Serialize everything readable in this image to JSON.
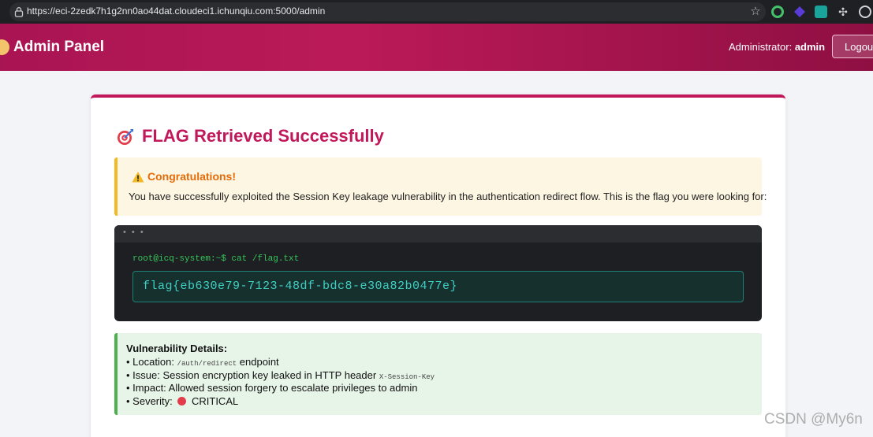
{
  "browser": {
    "url": "https://eci-2zedk7h1g2nn0ao44dat.cloudeci1.ichunqiu.com:5000/admin"
  },
  "header": {
    "title": "Admin Panel",
    "admin_label": "Administrator:",
    "admin_name": "admin",
    "logout_label": "Logout"
  },
  "card": {
    "title": "FLAG Retrieved Successfully",
    "warning": {
      "title": "Congratulations!",
      "text": "You have successfully exploited the Session Key leakage vulnerability in the authentication redirect flow. This is the flag you were looking for:"
    },
    "terminal": {
      "dots": "• • •",
      "command": "root@icq-system:~$ cat /flag.txt",
      "flag": "flag{eb630e79-7123-48df-bdc8-e30a82b0477e}"
    },
    "details": {
      "title": "Vulnerability Details:",
      "location_prefix": "• Location: ",
      "location_code": "/auth/redirect",
      "location_suffix": " endpoint",
      "issue_prefix": "• Issue: Session encryption key leaked in HTTP header ",
      "issue_code": "X-Session-Key",
      "impact": "• Impact: Allowed session forgery to escalate privileges to admin",
      "severity_prefix": "• Severity: ",
      "severity_value": "CRITICAL"
    }
  },
  "watermark": "CSDN @My6n",
  "colors": {
    "brand": "#c0185a",
    "warning_accent": "#f2b825",
    "success_accent": "#4caf50",
    "flag_text": "#3fd0c5",
    "prompt_text": "#35c45b"
  }
}
